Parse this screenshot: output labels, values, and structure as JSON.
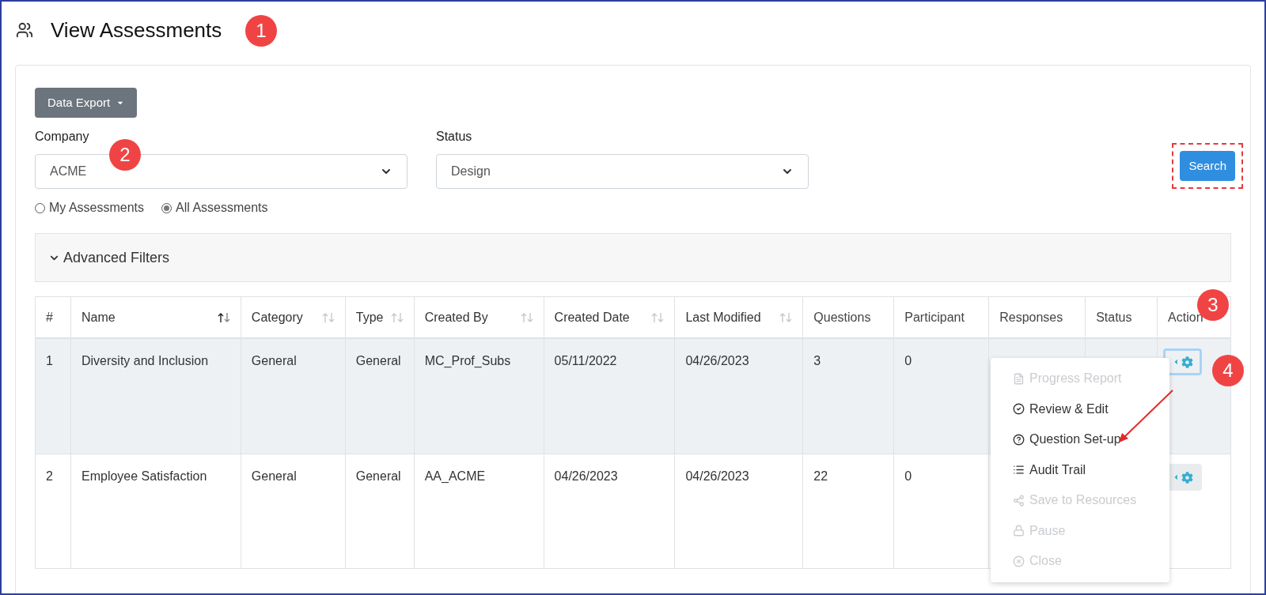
{
  "page": {
    "title": "View Assessments"
  },
  "callouts": [
    "1",
    "2",
    "3",
    "4"
  ],
  "toolbar": {
    "export_button": "Data Export"
  },
  "filters": {
    "company": {
      "label": "Company",
      "value": "ACME"
    },
    "status": {
      "label": "Status",
      "value": "Design"
    },
    "search_button": "Search",
    "search_highlighted": true
  },
  "scope_options": [
    {
      "label": "My Assessments",
      "selected": false
    },
    {
      "label": "All Assessments",
      "selected": true
    }
  ],
  "advanced_filters": {
    "label": "Advanced Filters",
    "expanded": false
  },
  "table": {
    "columns": [
      {
        "label": "#",
        "sortable": false
      },
      {
        "label": "Name",
        "sortable": true,
        "sorted": true
      },
      {
        "label": "Category",
        "sortable": true,
        "sorted": false
      },
      {
        "label": "Type",
        "sortable": true,
        "sorted": false
      },
      {
        "label": "Created By",
        "sortable": true,
        "sorted": false
      },
      {
        "label": "Created Date",
        "sortable": true,
        "sorted": false
      },
      {
        "label": "Last Modified",
        "sortable": true,
        "sorted": false
      },
      {
        "label": "Questions",
        "sortable": false
      },
      {
        "label": "Participant",
        "sortable": false
      },
      {
        "label": "Responses",
        "sortable": false
      },
      {
        "label": "Status",
        "sortable": false
      },
      {
        "label": "Action",
        "sortable": false
      }
    ],
    "rows": [
      {
        "selected": true,
        "menu_open": true,
        "cells": [
          "1",
          "Diversity and Inclusion",
          "General",
          "General",
          "MC_Prof_Subs",
          "05/11/2022",
          "04/26/2023",
          "3",
          "0"
        ]
      },
      {
        "selected": false,
        "menu_open": false,
        "cells": [
          "2",
          "Employee Satisfaction",
          "General",
          "General",
          "AA_ACME",
          "04/26/2023",
          "04/26/2023",
          "22",
          "0"
        ]
      }
    ]
  },
  "action_menu": [
    {
      "kind": "report",
      "label": "Progress Report",
      "disabled": true
    },
    {
      "kind": "review",
      "label": "Review & Edit",
      "disabled": false
    },
    {
      "kind": "question",
      "label": "Question Set-up",
      "disabled": false
    },
    {
      "kind": "audit",
      "label": "Audit Trail",
      "disabled": false
    },
    {
      "kind": "share",
      "label": "Save to Resources",
      "disabled": true
    },
    {
      "kind": "lock",
      "label": "Pause",
      "disabled": true
    },
    {
      "kind": "close",
      "label": "Close",
      "disabled": true
    }
  ]
}
